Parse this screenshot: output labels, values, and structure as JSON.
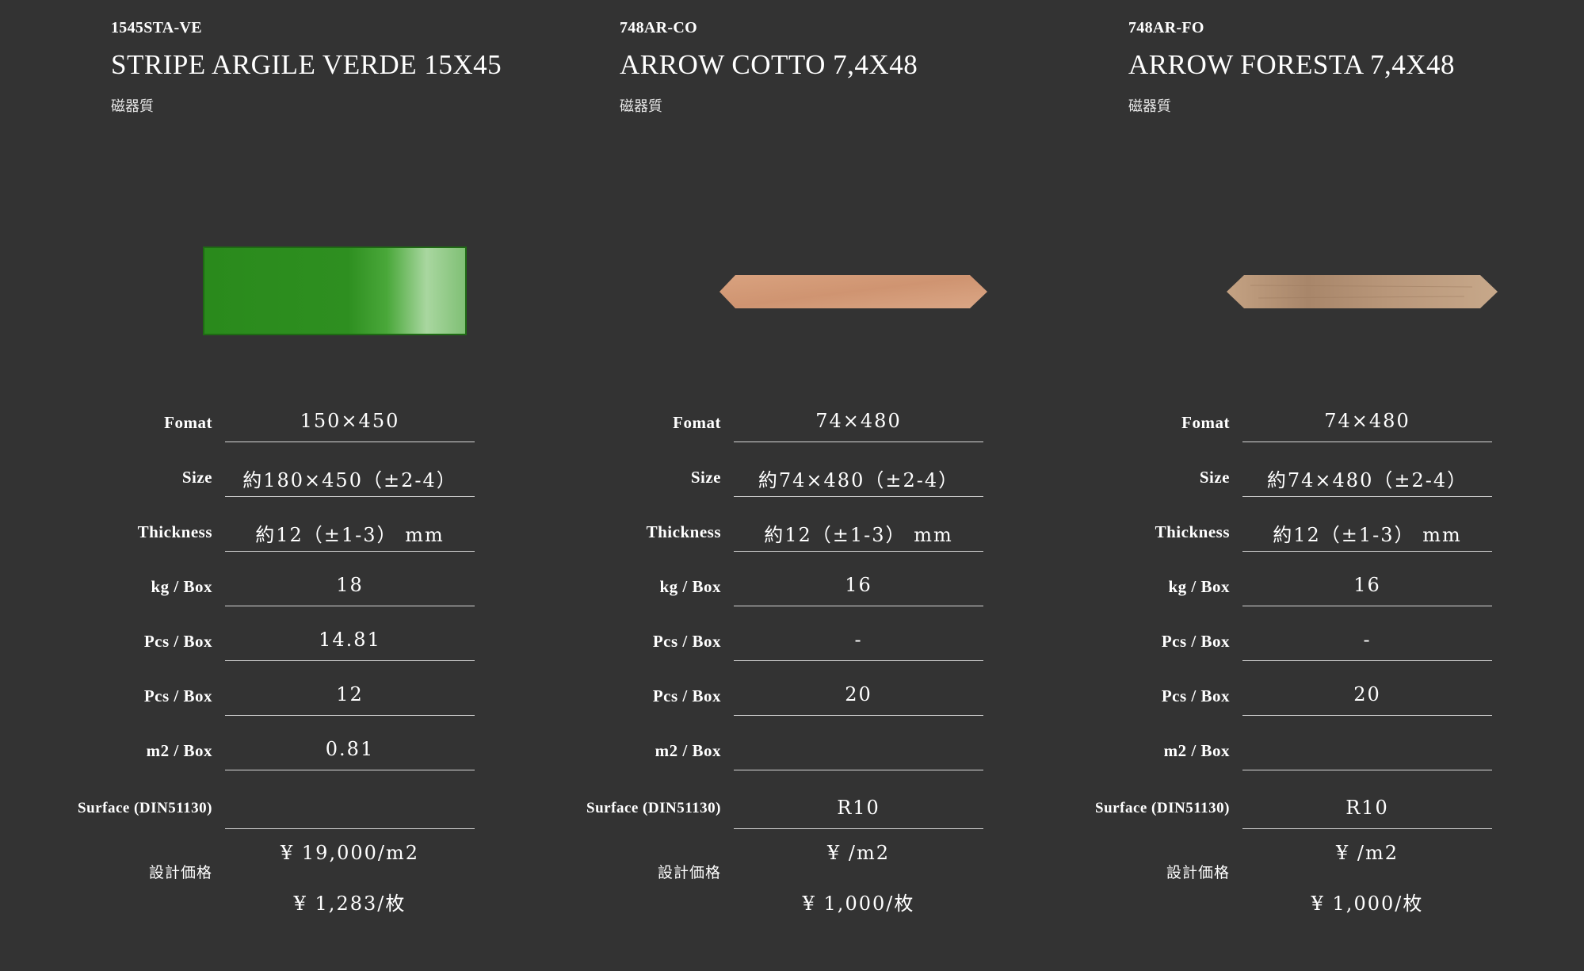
{
  "products": [
    {
      "code": "1545STA-VE",
      "name": "STRIPE ARGILE VERDE 15X45",
      "material": "磁器質",
      "tile_color": "#2e8a1f",
      "specs": [
        {
          "label": "Fomat",
          "value": "150×450"
        },
        {
          "label": "Size",
          "value": "約180×450（±2-4）"
        },
        {
          "label": "Thickness",
          "value": "約12（±1-3） mm"
        },
        {
          "label": "kg / Box",
          "value": "18"
        },
        {
          "label": "Pcs / Box",
          "value": "14.81"
        },
        {
          "label": "Pcs / Box",
          "value": "12"
        },
        {
          "label": "m2 / Box",
          "value": "0.81"
        },
        {
          "label": "Surface (DIN51130)",
          "value": ""
        }
      ],
      "price_label": "設計価格",
      "price_m2": "¥ 19,000/m2",
      "price_piece": "¥ 1,283/枚"
    },
    {
      "code": "748AR-CO",
      "name": "ARROW COTTO 7,4X48",
      "material": "磁器質",
      "tile_color": "#d59a78",
      "specs": [
        {
          "label": "Fomat",
          "value": "74×480"
        },
        {
          "label": "Size",
          "value": "約74×480（±2-4）"
        },
        {
          "label": "Thickness",
          "value": "約12（±1-3） mm"
        },
        {
          "label": "kg / Box",
          "value": "16"
        },
        {
          "label": "Pcs / Box",
          "value": "-"
        },
        {
          "label": "Pcs / Box",
          "value": "20"
        },
        {
          "label": "m2 / Box",
          "value": ""
        },
        {
          "label": "Surface (DIN51130)",
          "value": "R10"
        }
      ],
      "price_label": "設計価格",
      "price_m2": "¥ /m2",
      "price_piece": "¥ 1,000/枚"
    },
    {
      "code": "748AR-FO",
      "name": "ARROW FORESTA 7,4X48",
      "material": "磁器質",
      "tile_color": "#b08f72",
      "specs": [
        {
          "label": "Fomat",
          "value": "74×480"
        },
        {
          "label": "Size",
          "value": "約74×480（±2-4）"
        },
        {
          "label": "Thickness",
          "value": "約12（±1-3） mm"
        },
        {
          "label": "kg / Box",
          "value": "16"
        },
        {
          "label": "Pcs / Box",
          "value": "-"
        },
        {
          "label": "Pcs / Box",
          "value": "20"
        },
        {
          "label": "m2 / Box",
          "value": ""
        },
        {
          "label": "Surface (DIN51130)",
          "value": "R10"
        }
      ],
      "price_label": "設計価格",
      "price_m2": "¥ /m2",
      "price_piece": "¥ 1,000/枚"
    }
  ]
}
